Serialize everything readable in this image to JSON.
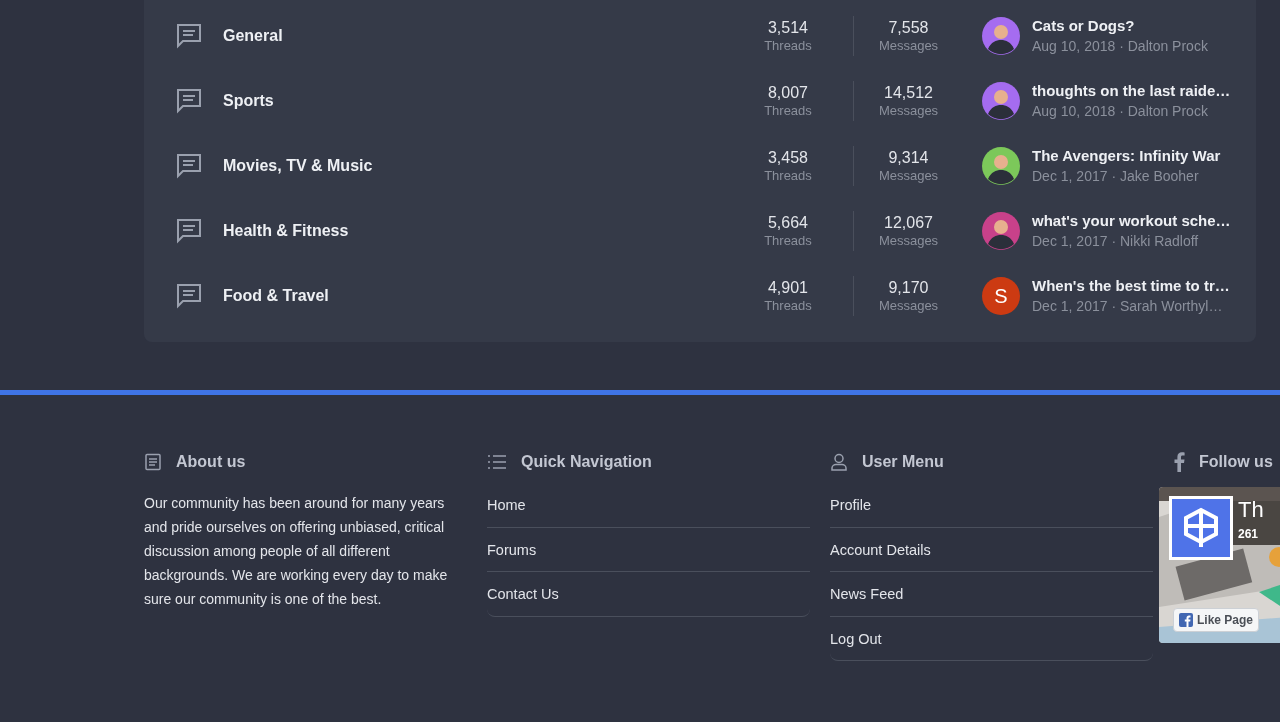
{
  "forums": [
    {
      "title": "General",
      "threads": "3,514",
      "threads_label": "Threads",
      "messages": "7,558",
      "messages_label": "Messages",
      "latest": {
        "title": "Cats or Dogs?",
        "meta": "Aug 10, 2018 · Dalton Prock",
        "avatar": {
          "kind": "silhouette",
          "color": "#a56cf0"
        }
      }
    },
    {
      "title": "Sports",
      "threads": "8,007",
      "threads_label": "Threads",
      "messages": "14,512",
      "messages_label": "Messages",
      "latest": {
        "title": "thoughts on the last raide…",
        "meta": "Aug 10, 2018 · Dalton Prock",
        "avatar": {
          "kind": "silhouette",
          "color": "#a56cf0"
        }
      }
    },
    {
      "title": "Movies, TV & Music",
      "threads": "3,458",
      "threads_label": "Threads",
      "messages": "9,314",
      "messages_label": "Messages",
      "latest": {
        "title": "The Avengers: Infinity War",
        "meta": "Dec 1, 2017 · Jake Booher",
        "avatar": {
          "kind": "silhouette",
          "color": "#7cc85a"
        }
      }
    },
    {
      "title": "Health & Fitness",
      "threads": "5,664",
      "threads_label": "Threads",
      "messages": "12,067",
      "messages_label": "Messages",
      "latest": {
        "title": "what's your workout sche…",
        "meta": "Dec 1, 2017 · Nikki Radloff",
        "avatar": {
          "kind": "silhouette",
          "color": "#c8418a"
        }
      }
    },
    {
      "title": "Food & Travel",
      "threads": "4,901",
      "threads_label": "Threads",
      "messages": "9,170",
      "messages_label": "Messages",
      "latest": {
        "title": "When's the best time to tr…",
        "meta": "Dec 1, 2017 · Sarah Worthyl…",
        "avatar": {
          "kind": "letter",
          "letter": "S",
          "color": "#cc3a12"
        }
      }
    }
  ],
  "footer": {
    "about": {
      "heading": "About us",
      "text": "Our community has been around for many years and pride ourselves on offering unbiased, critical discussion among people of all different backgrounds. We are working every day to make sure our community is one of the best."
    },
    "quick_navigation": {
      "heading": "Quick Navigation",
      "links": [
        "Home",
        "Forums",
        "Contact Us"
      ]
    },
    "user_menu": {
      "heading": "User Menu",
      "links": [
        "Profile",
        "Account Details",
        "News Feed",
        "Log Out"
      ]
    },
    "follow_us": {
      "heading": "Follow us",
      "page_title": "Th",
      "likes": "261",
      "like_button": "Like Page"
    }
  }
}
